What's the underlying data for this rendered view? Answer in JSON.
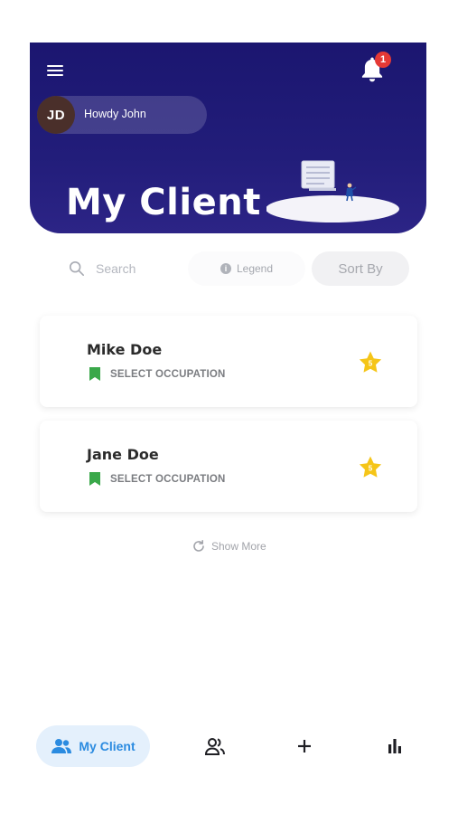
{
  "header": {
    "page_title": "My Client",
    "greeting": "Howdy John",
    "avatar_initials": "JD",
    "notification_count": "1",
    "icons": {
      "menu": "hamburger-menu-icon",
      "bell": "bell-icon"
    }
  },
  "toolbar": {
    "search_placeholder": "Search",
    "legend_label": "Legend",
    "legend_icon": "i",
    "sort_label": "Sort By"
  },
  "clients": [
    {
      "name": "Mike Doe",
      "occupation": "SELECT OCCUPATION",
      "rating": "5"
    },
    {
      "name": "Jane Doe",
      "occupation": "SELECT OCCUPATION",
      "rating": "5"
    }
  ],
  "show_more_label": "Show More",
  "bottom_nav": {
    "active_label": "My Client",
    "items": [
      "clients-icon",
      "contacts-icon",
      "add-icon",
      "stats-icon"
    ]
  },
  "colors": {
    "header_bg": "#1b1670",
    "accent_blue": "#2b8be0",
    "star": "#f5c518",
    "bookmark": "#3aa84a",
    "badge": "#e53935"
  }
}
